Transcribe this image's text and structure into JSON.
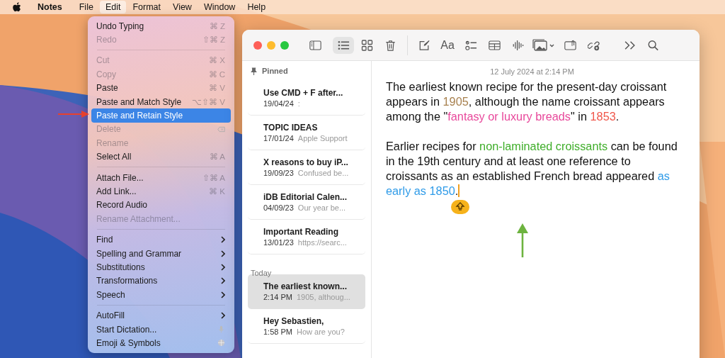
{
  "menu_bar": {
    "app": "Notes",
    "items": [
      {
        "label": "File",
        "selected": false
      },
      {
        "label": "Edit",
        "selected": true
      },
      {
        "label": "Format",
        "selected": false
      },
      {
        "label": "View",
        "selected": false
      },
      {
        "label": "Window",
        "selected": false
      },
      {
        "label": "Help",
        "selected": false
      }
    ]
  },
  "edit_menu": {
    "groups": [
      [
        {
          "label": "Undo Typing",
          "shortcut": "⌘ Z",
          "disabled": false,
          "selected": false
        },
        {
          "label": "Redo",
          "shortcut": "⇧⌘ Z",
          "disabled": true,
          "selected": false
        }
      ],
      [
        {
          "label": "Cut",
          "shortcut": "⌘ X",
          "disabled": true,
          "selected": false
        },
        {
          "label": "Copy",
          "shortcut": "⌘ C",
          "disabled": true,
          "selected": false
        },
        {
          "label": "Paste",
          "shortcut": "⌘ V",
          "disabled": false,
          "selected": false
        },
        {
          "label": "Paste and Match Style",
          "shortcut": "⌥⇧⌘ V",
          "disabled": false,
          "selected": false
        },
        {
          "label": "Paste and Retain Style",
          "disabled": false,
          "selected": true
        },
        {
          "label": "Delete",
          "disabled": true,
          "selected": false,
          "kind": "delete"
        },
        {
          "label": "Rename",
          "disabled": true,
          "selected": false
        },
        {
          "label": "Select All",
          "shortcut": "⌘ A",
          "disabled": false,
          "selected": false
        }
      ],
      [
        {
          "label": "Attach File...",
          "shortcut": "⇧⌘ A",
          "disabled": false,
          "selected": false
        },
        {
          "label": "Add Link...",
          "shortcut": "⌘ K",
          "disabled": false,
          "selected": false
        },
        {
          "label": "Record Audio",
          "disabled": false,
          "selected": false
        },
        {
          "label": "Rename Attachment...",
          "disabled": true,
          "selected": false
        }
      ],
      [
        {
          "label": "Find",
          "disabled": false,
          "selected": false,
          "kind": "submenu"
        },
        {
          "label": "Spelling and Grammar",
          "disabled": false,
          "selected": false,
          "kind": "submenu"
        },
        {
          "label": "Substitutions",
          "disabled": false,
          "selected": false,
          "kind": "submenu"
        },
        {
          "label": "Transformations",
          "disabled": false,
          "selected": false,
          "kind": "submenu"
        },
        {
          "label": "Speech",
          "disabled": false,
          "selected": false,
          "kind": "submenu"
        }
      ],
      [
        {
          "label": "AutoFill",
          "disabled": false,
          "selected": false,
          "kind": "submenu"
        },
        {
          "label": "Start Dictation...",
          "disabled": false,
          "selected": false,
          "kind": "dictation"
        },
        {
          "label": "Emoji & Symbols",
          "disabled": false,
          "selected": false,
          "kind": "emoji"
        }
      ]
    ]
  },
  "toolbar": {
    "buttons": [
      {
        "kind": "sidebar"
      },
      {
        "kind": "list-view",
        "selected": true
      },
      {
        "kind": "gallery-view",
        "selected": false
      },
      {
        "kind": "delete"
      },
      {
        "kind": "divider"
      },
      {
        "kind": "compose"
      },
      {
        "kind": "format",
        "label": "Aa"
      },
      {
        "kind": "checklist"
      },
      {
        "kind": "table"
      },
      {
        "kind": "audio"
      },
      {
        "kind": "media"
      },
      {
        "kind": "attachment"
      },
      {
        "kind": "collaborate"
      },
      {
        "kind": "more"
      },
      {
        "kind": "search"
      }
    ]
  },
  "notes_list": {
    "sections": [
      {
        "title": "Pinned",
        "pinned": true,
        "notes": [
          {
            "title": "Use CMD + F after...",
            "date": "19/04/24",
            "snippet": ":",
            "selected": false
          },
          {
            "title": "TOPIC IDEAS",
            "date": "17/01/24",
            "snippet": "Apple Support",
            "selected": false
          },
          {
            "title": "X reasons to buy iP...",
            "date": "19/09/23",
            "snippet": "Confused be...",
            "selected": false
          },
          {
            "title": "iDB Editorial Calen...",
            "date": "04/09/23",
            "snippet": "Our year be...",
            "selected": false
          },
          {
            "title": "Important Reading",
            "date": "13/01/23",
            "snippet": "https://searc...",
            "selected": false
          }
        ]
      },
      {
        "title": "Today",
        "pinned": false,
        "notes": [
          {
            "title": "The earliest known...",
            "date": "2:14 PM",
            "snippet": "1905, althoug...",
            "selected": true
          },
          {
            "title": "Hey Sebastien,",
            "date": "1:58 PM",
            "snippet": "How are you?",
            "selected": false
          }
        ]
      }
    ]
  },
  "note": {
    "date": "12 July 2024 at 2:14 PM",
    "paragraphs": [
      [
        {
          "text": "The earliest known recipe for the present-day croissant appears in "
        },
        {
          "text": "1905",
          "color": "#a8814f"
        },
        {
          "text": ", although the name croissant appears among the \""
        },
        {
          "text": "fantasy or luxury breads",
          "color": "#e8489b"
        },
        {
          "text": "\" in "
        },
        {
          "text": "1853",
          "color": "#f0564a"
        },
        {
          "text": "."
        }
      ],
      [
        {
          "text": "Earlier recipes for "
        },
        {
          "text": "non-laminated croissants",
          "color": "#3fae2a"
        },
        {
          "text": " can be found in the 19th century and at least one reference to croissants as an established French bread appeared "
        },
        {
          "text": "as early as 1850",
          "color": "#2f9be8"
        },
        {
          "text": "."
        }
      ]
    ]
  }
}
